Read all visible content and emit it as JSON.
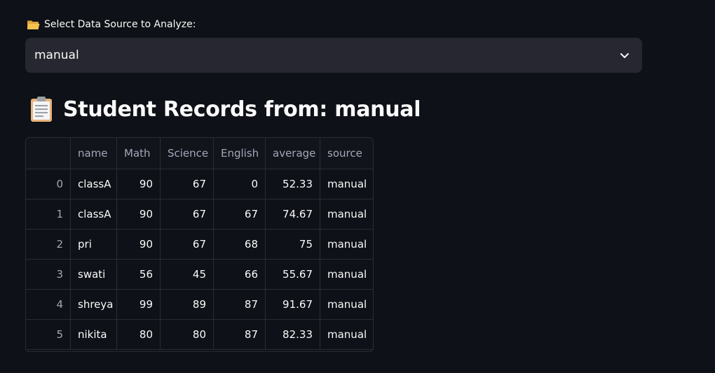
{
  "selector": {
    "label": "Select Data Source to Analyze:",
    "icon": "folder-icon",
    "value": "manual"
  },
  "heading": {
    "icon": "clipboard-icon",
    "text": "Student Records from: manual"
  },
  "table": {
    "columns": [
      "",
      "name",
      "Math",
      "Science",
      "English",
      "average",
      "source"
    ],
    "rows": [
      {
        "index": "0",
        "name": "classA",
        "math": "90",
        "science": "67",
        "english": "0",
        "average": "52.33",
        "source": "manual"
      },
      {
        "index": "1",
        "name": "classA",
        "math": "90",
        "science": "67",
        "english": "67",
        "average": "74.67",
        "source": "manual"
      },
      {
        "index": "2",
        "name": "pri",
        "math": "90",
        "science": "67",
        "english": "68",
        "average": "75",
        "source": "manual"
      },
      {
        "index": "3",
        "name": "swati",
        "math": "56",
        "science": "45",
        "english": "66",
        "average": "55.67",
        "source": "manual"
      },
      {
        "index": "4",
        "name": "shreya",
        "math": "99",
        "science": "89",
        "english": "87",
        "average": "91.67",
        "source": "manual"
      },
      {
        "index": "5",
        "name": "nikita",
        "math": "80",
        "science": "80",
        "english": "87",
        "average": "82.33",
        "source": "manual"
      }
    ]
  }
}
